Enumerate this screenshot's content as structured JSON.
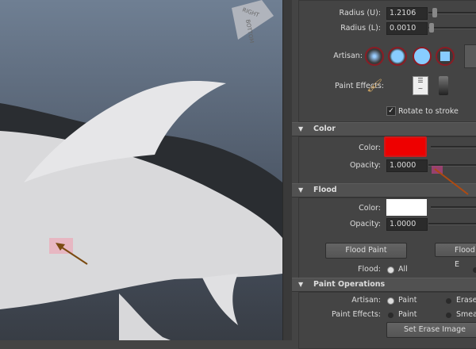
{
  "viewport": {
    "view_cube": {
      "top": "RIGHT",
      "side": "BOTTOM"
    }
  },
  "brush": {
    "radius_u_label": "Radius (U):",
    "radius_u": "1.2106",
    "radius_l_label": "Radius (L):",
    "radius_l": "0.0010",
    "artisan_label": "Artisan:",
    "paint_effects_label": "Paint Effects:",
    "rotate_label": "Rotate to stroke",
    "rotate_checked": true
  },
  "color": {
    "header": "Color",
    "color_label": "Color:",
    "color_value": "#ee0000",
    "opacity_label": "Opacity:",
    "opacity": "1.0000"
  },
  "flood": {
    "header": "Flood",
    "color_label": "Color:",
    "color_value": "#ffffff",
    "opacity_label": "Opacity:",
    "opacity": "1.0000",
    "flood_paint": "Flood Paint",
    "flood_erase": "Flood E",
    "flood_label": "Flood:",
    "flood_all": "All"
  },
  "paint_ops": {
    "header": "Paint Operations",
    "artisan_label": "Artisan:",
    "artisan_paint": "Paint",
    "artisan_erase": "Erase",
    "pe_label": "Paint Effects:",
    "pe_paint": "Paint",
    "pe_smear": "Smear",
    "set_erase": "Set Erase Image"
  }
}
